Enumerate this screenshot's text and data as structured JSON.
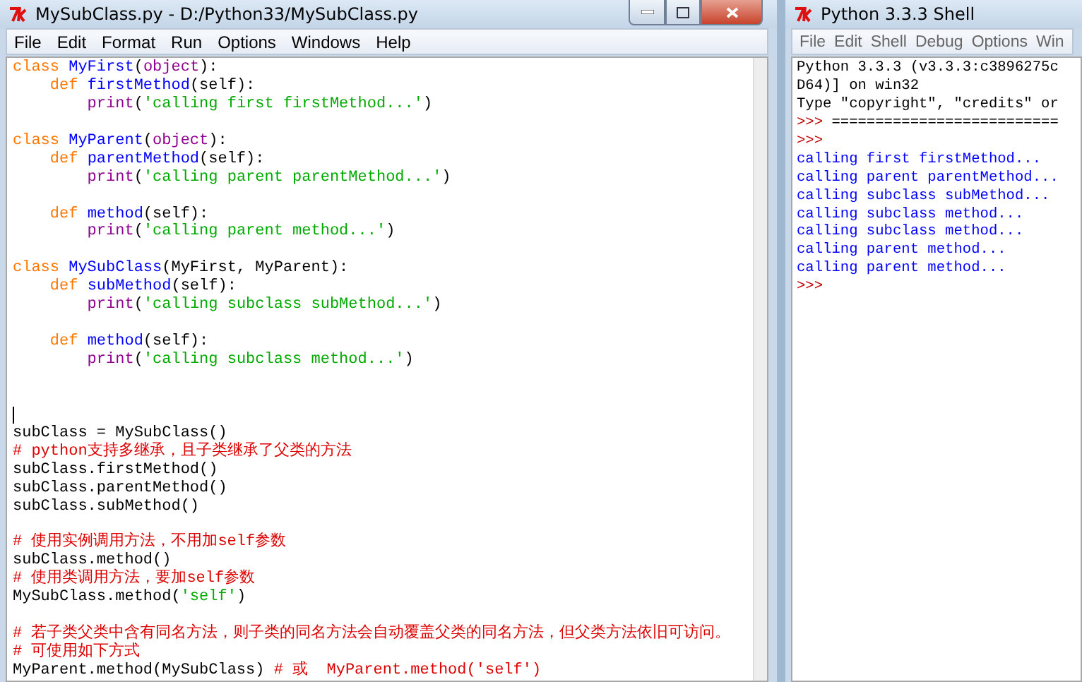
{
  "editor": {
    "title": "MySubClass.py - D:/Python33/MySubClass.py",
    "menu": [
      "File",
      "Edit",
      "Format",
      "Run",
      "Options",
      "Windows",
      "Help"
    ],
    "lines": [
      {
        "tokens": [
          {
            "kind": "keyword",
            "text": "class "
          },
          {
            "kind": "definition",
            "text": "MyFirst"
          },
          {
            "kind": "plain",
            "text": "("
          },
          {
            "kind": "builtin",
            "text": "object"
          },
          {
            "kind": "plain",
            "text": "):"
          }
        ]
      },
      {
        "tokens": [
          {
            "kind": "keyword",
            "text": "    def "
          },
          {
            "kind": "definition",
            "text": "firstMethod"
          },
          {
            "kind": "plain",
            "text": "(self):"
          }
        ]
      },
      {
        "tokens": [
          {
            "kind": "builtin",
            "text": "        print"
          },
          {
            "kind": "plain",
            "text": "("
          },
          {
            "kind": "string",
            "text": "'calling first firstMethod...'"
          },
          {
            "kind": "plain",
            "text": ")"
          }
        ]
      },
      {
        "blank_before": true,
        "tokens": [
          {
            "kind": "keyword",
            "text": "class "
          },
          {
            "kind": "definition",
            "text": "MyParent"
          },
          {
            "kind": "plain",
            "text": "("
          },
          {
            "kind": "builtin",
            "text": "object"
          },
          {
            "kind": "plain",
            "text": "):"
          }
        ]
      },
      {
        "tokens": [
          {
            "kind": "keyword",
            "text": "    def "
          },
          {
            "kind": "definition",
            "text": "parentMethod"
          },
          {
            "kind": "plain",
            "text": "(self):"
          }
        ]
      },
      {
        "tokens": [
          {
            "kind": "builtin",
            "text": "        print"
          },
          {
            "kind": "plain",
            "text": "("
          },
          {
            "kind": "string",
            "text": "'calling parent parentMethod...'"
          },
          {
            "kind": "plain",
            "text": ")"
          }
        ]
      },
      {
        "blank_before": true,
        "tokens": [
          {
            "kind": "keyword",
            "text": "    def "
          },
          {
            "kind": "definition",
            "text": "method"
          },
          {
            "kind": "plain",
            "text": "(self):"
          }
        ]
      },
      {
        "tokens": [
          {
            "kind": "builtin",
            "text": "        print"
          },
          {
            "kind": "plain",
            "text": "("
          },
          {
            "kind": "string",
            "text": "'calling parent method...'"
          },
          {
            "kind": "plain",
            "text": ")"
          }
        ]
      },
      {
        "blank_before": true,
        "tokens": [
          {
            "kind": "keyword",
            "text": "class "
          },
          {
            "kind": "definition",
            "text": "MySubClass"
          },
          {
            "kind": "plain",
            "text": "(MyFirst, MyParent):"
          }
        ]
      },
      {
        "tokens": [
          {
            "kind": "keyword",
            "text": "    def "
          },
          {
            "kind": "definition",
            "text": "subMethod"
          },
          {
            "kind": "plain",
            "text": "(self):"
          }
        ]
      },
      {
        "tokens": [
          {
            "kind": "builtin",
            "text": "        print"
          },
          {
            "kind": "plain",
            "text": "("
          },
          {
            "kind": "string",
            "text": "'calling subclass subMethod...'"
          },
          {
            "kind": "plain",
            "text": ")"
          }
        ]
      },
      {
        "blank_before": true,
        "tokens": [
          {
            "kind": "keyword",
            "text": "    def "
          },
          {
            "kind": "definition",
            "text": "method"
          },
          {
            "kind": "plain",
            "text": "(self):"
          }
        ]
      },
      {
        "blank_after": true,
        "tokens": [
          {
            "kind": "builtin",
            "text": "        print"
          },
          {
            "kind": "plain",
            "text": "("
          },
          {
            "kind": "string",
            "text": "'calling subclass method...'"
          },
          {
            "kind": "plain",
            "text": ")"
          }
        ]
      },
      {
        "blank_before": true,
        "cursor": true
      },
      {
        "tokens": [
          {
            "kind": "plain",
            "text": "subClass = MySubClass()"
          }
        ]
      },
      {
        "tokens": [
          {
            "kind": "comment",
            "text": "# python支持多继承，且子类继承了父类的方法"
          }
        ]
      },
      {
        "tokens": [
          {
            "kind": "plain",
            "text": "subClass.firstMethod()"
          }
        ]
      },
      {
        "tokens": [
          {
            "kind": "plain",
            "text": "subClass.parentMethod()"
          }
        ]
      },
      {
        "tokens": [
          {
            "kind": "plain",
            "text": "subClass.subMethod()"
          }
        ]
      },
      {
        "blank_before": true,
        "tokens": [
          {
            "kind": "comment",
            "text": "# 使用实例调用方法，不用加self参数"
          }
        ]
      },
      {
        "tokens": [
          {
            "kind": "plain",
            "text": "subClass.method()"
          }
        ]
      },
      {
        "tokens": [
          {
            "kind": "comment",
            "text": "# 使用类调用方法，要加self参数"
          }
        ]
      },
      {
        "tokens": [
          {
            "kind": "plain",
            "text": "MySubClass.method("
          },
          {
            "kind": "string",
            "text": "'self'"
          },
          {
            "kind": "plain",
            "text": ")"
          }
        ]
      },
      {
        "blank_before": true,
        "tokens": [
          {
            "kind": "comment",
            "text": "# 若子类父类中含有同名方法，则子类的同名方法会自动覆盖父类的同名方法，但父类方法依旧可访问。"
          }
        ]
      },
      {
        "tokens": [
          {
            "kind": "comment",
            "text": "# 可使用如下方式"
          }
        ]
      },
      {
        "tokens": [
          {
            "kind": "plain",
            "text": "MyParent.method(MySubClass) "
          },
          {
            "kind": "comment",
            "text": "# 或  MyParent.method('self')"
          }
        ]
      }
    ]
  },
  "shell": {
    "title": "Python 3.3.3 Shell",
    "menu": [
      "File",
      "Edit",
      "Shell",
      "Debug",
      "Options",
      "Win"
    ],
    "lines": [
      {
        "tokens": [
          {
            "kind": "plain",
            "text": "Python 3.3.3 (v3.3.3:c3896275c"
          }
        ]
      },
      {
        "tokens": [
          {
            "kind": "plain",
            "text": "D64)] on win32"
          }
        ]
      },
      {
        "tokens": [
          {
            "kind": "plain",
            "text": "Type \"copyright\", \"credits\" or"
          }
        ]
      },
      {
        "tokens": [
          {
            "kind": "prompt",
            "text": ">>> "
          },
          {
            "kind": "plain",
            "text": "=========================="
          }
        ]
      },
      {
        "tokens": [
          {
            "kind": "prompt",
            "text": ">>>"
          }
        ]
      },
      {
        "tokens": [
          {
            "kind": "output",
            "text": "calling first firstMethod..."
          }
        ]
      },
      {
        "tokens": [
          {
            "kind": "output",
            "text": "calling parent parentMethod..."
          }
        ]
      },
      {
        "tokens": [
          {
            "kind": "output",
            "text": "calling subclass subMethod..."
          }
        ]
      },
      {
        "tokens": [
          {
            "kind": "output",
            "text": "calling subclass method..."
          }
        ]
      },
      {
        "tokens": [
          {
            "kind": "output",
            "text": "calling subclass method..."
          }
        ]
      },
      {
        "tokens": [
          {
            "kind": "output",
            "text": "calling parent method..."
          }
        ]
      },
      {
        "tokens": [
          {
            "kind": "output",
            "text": "calling parent method..."
          }
        ]
      },
      {
        "tokens": [
          {
            "kind": "prompt",
            "text": ">>>"
          }
        ]
      }
    ]
  }
}
